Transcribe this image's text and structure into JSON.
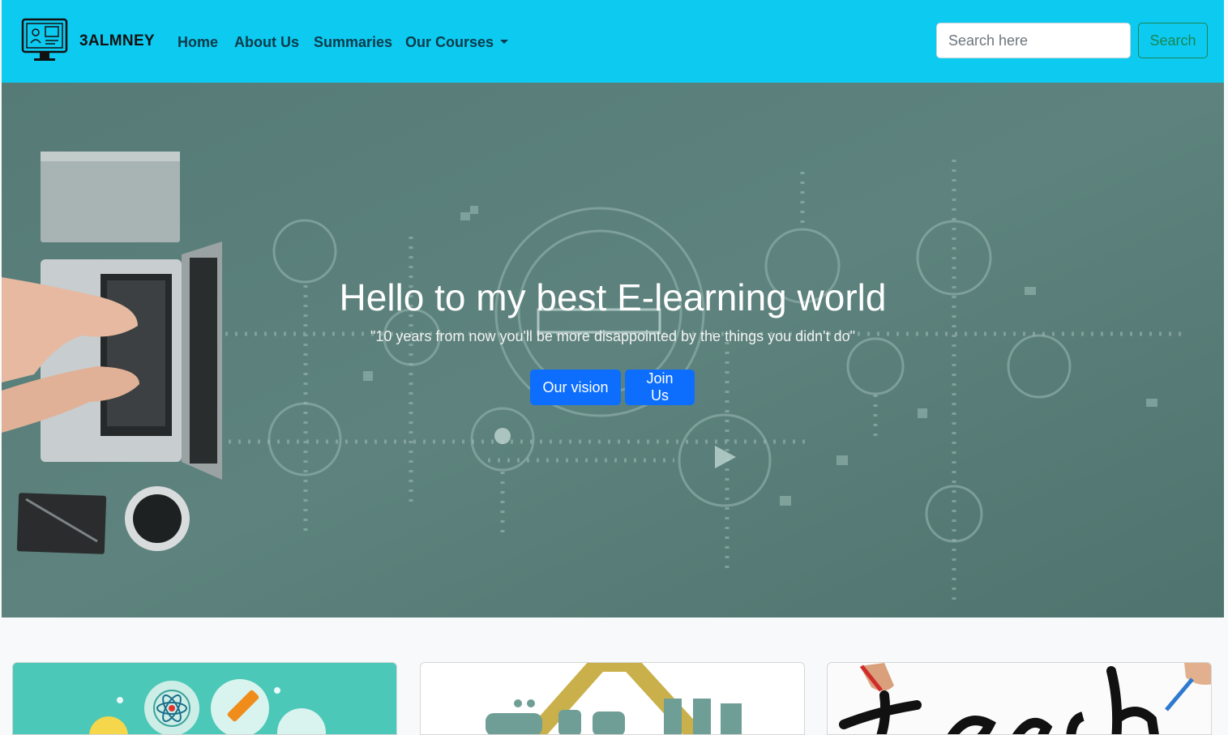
{
  "brand": {
    "name": "3ALMNEY",
    "logo_icon": "computer-learning-icon"
  },
  "nav": {
    "items": [
      {
        "label": "Home"
      },
      {
        "label": "About Us"
      },
      {
        "label": "Summaries"
      },
      {
        "label": "Our Courses",
        "dropdown": true
      }
    ]
  },
  "search": {
    "placeholder": "Search here",
    "value": "",
    "button_label": "Search"
  },
  "hero": {
    "title": "Hello to my best E-learning world",
    "quote": "\"10 years from now you'll be more disappointed by the things you didn't do\"",
    "buttons": [
      {
        "label": "Our vision"
      },
      {
        "label": "Join Us"
      }
    ]
  },
  "cards": [
    {
      "image": "science-icons-illustration"
    },
    {
      "image": "arabic-language-logo"
    },
    {
      "image": "english-handwriting-illustration"
    }
  ],
  "colors": {
    "navbar": "#0dcaf0",
    "primary": "#0d6efd",
    "success": "#198754",
    "hero_overlay": "#5b7f79"
  }
}
